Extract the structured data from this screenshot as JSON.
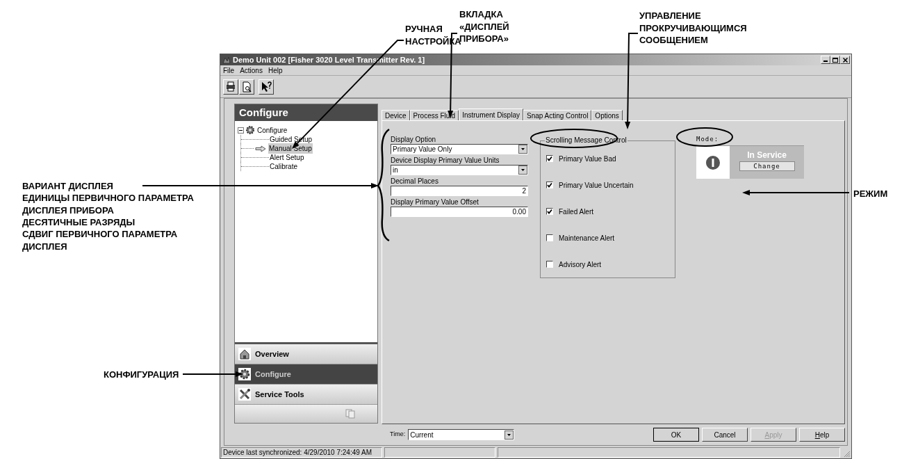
{
  "window": {
    "title": "Demo Unit 002 [Fisher 3020 Level Transmitter Rev. 1]"
  },
  "menu": [
    "File",
    "Actions",
    "Help"
  ],
  "sidebar": {
    "title": "Configure",
    "tree": [
      {
        "label": "Configure",
        "expanded": true,
        "selected": false,
        "children": [
          {
            "label": "Guided Setup",
            "selected": false
          },
          {
            "label": "Manual Setup",
            "selected": true
          },
          {
            "label": "Alert Setup",
            "selected": false
          },
          {
            "label": "Calibrate",
            "selected": false
          }
        ]
      }
    ],
    "nav": [
      {
        "label": "Overview",
        "kind": "home",
        "selected": false
      },
      {
        "label": "Configure",
        "kind": "gear",
        "selected": true
      },
      {
        "label": "Service Tools",
        "kind": "tools",
        "selected": false
      }
    ]
  },
  "tabs": [
    {
      "label": "Device",
      "selected": false
    },
    {
      "label": "Process Fluid",
      "selected": false
    },
    {
      "label": "Instrument Display",
      "selected": true
    },
    {
      "label": "Snap Acting Control",
      "selected": false
    },
    {
      "label": "Options",
      "selected": false
    }
  ],
  "fields": [
    {
      "label": "Display Option",
      "kind": "dropdown",
      "value": "Primary Value Only"
    },
    {
      "label": "Device Display Primary Value Units",
      "kind": "dropdown",
      "value": "in"
    },
    {
      "label": "Decimal Places",
      "kind": "number",
      "value": "2"
    },
    {
      "label": "Display Primary Value Offset",
      "kind": "number",
      "value": "0.00"
    }
  ],
  "scrolling_message_control": {
    "title": "Scrolling Message Control",
    "options": [
      {
        "label": "Primary Value Bad",
        "checked": true
      },
      {
        "label": "Primary Value Uncertain",
        "checked": true
      },
      {
        "label": "Failed Alert",
        "checked": true
      },
      {
        "label": "Maintenance Alert",
        "checked": false
      },
      {
        "label": "Advisory Alert",
        "checked": false
      }
    ]
  },
  "mode": {
    "label": "Mode:",
    "status": "In Service",
    "button": "Change"
  },
  "time": {
    "label": "Time:",
    "value": "Current"
  },
  "buttons": [
    {
      "label": "OK",
      "disabled": false,
      "mnemonic": false
    },
    {
      "label": "Cancel",
      "disabled": false,
      "mnemonic": false
    },
    {
      "label": "Apply",
      "disabled": true,
      "mnemonic": true
    },
    {
      "label": "Help",
      "disabled": false,
      "mnemonic": true
    }
  ],
  "status_bar": [
    "Device last synchronized: 4/29/2010 7:24:49 AM"
  ],
  "callouts": [
    "РУЧНАЯ НАСТРОЙКА",
    "ВКЛАДКА «ДИСПЛЕЙ ПРИБОРА»",
    "УПРАВЛЕНИЕ ПРОКРУЧИВАЮЩИМСЯ СООБЩЕНИЕМ",
    "РЕЖИМ",
    "ВАРИАНТ ДИСПЛЕЯ",
    "ЕДИНИЦЫ ПЕРВИЧНОГО ПАРАМЕТРА ДИСПЛЕЯ ПРИБОРА",
    "ДЕСЯТИЧНЫЕ РАЗРЯДЫ",
    "СДВИГ ПЕРВИЧНОГО ПАРАМЕТРА ДИСПЛЕЯ",
    "КОНФИГУРАЦИЯ"
  ]
}
